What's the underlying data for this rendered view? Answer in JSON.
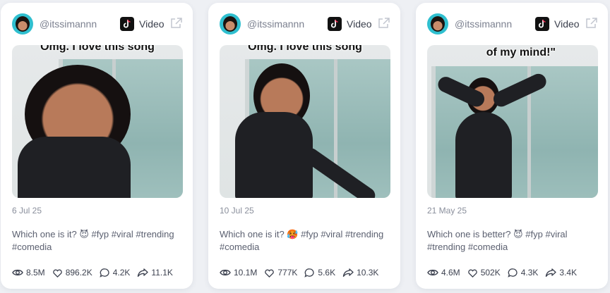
{
  "cards": [
    {
      "username": "@itssimannn",
      "platform_label": "Video",
      "overlay_text": "Omg. I love this song",
      "date": "6 Jul 25",
      "description": "Which one is it? 😈 #fyp #viral #trending #comedia",
      "views": "8.5M",
      "likes": "896.2K",
      "comments": "4.2K",
      "shares": "11.1K"
    },
    {
      "username": "@itssimannn",
      "platform_label": "Video",
      "overlay_text": "Omg. I love this song",
      "date": "10 Jul 25",
      "description": "Which one is it? 🥵 #fyp #viral #trending #comedia",
      "views": "10.1M",
      "likes": "777K",
      "comments": "5.6K",
      "shares": "10.3K"
    },
    {
      "username": "@itssimannn",
      "platform_label": "Video",
      "overlay_text": "of my mind!\"",
      "date": "21 May 25",
      "description": "Which one is better? 😈 #fyp #viral #trending #comedia",
      "views": "4.6M",
      "likes": "502K",
      "comments": "4.3K",
      "shares": "3.4K"
    }
  ],
  "icons": {
    "platform": "tiktok-icon",
    "external": "external-link-icon",
    "views": "eye-icon",
    "likes": "heart-icon",
    "comments": "comment-icon",
    "shares": "share-icon"
  },
  "colors": {
    "page_bg": "#eef0f4",
    "card_bg": "#ffffff",
    "muted_text": "#7c8190",
    "avatar_ring": "#2fbfcf"
  }
}
